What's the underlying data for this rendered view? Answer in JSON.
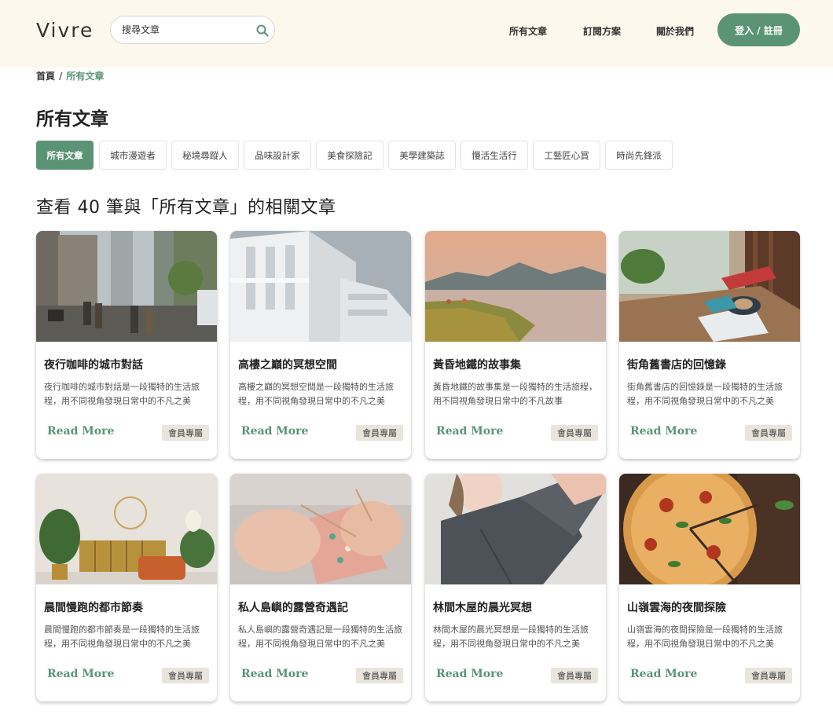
{
  "header": {
    "logo": "Vivre",
    "search": {
      "placeholder": "搜尋文章"
    },
    "nav": [
      {
        "label": "所有文章"
      },
      {
        "label": "訂閱方案"
      },
      {
        "label": "關於我們"
      }
    ],
    "login_label": "登入 / 註冊"
  },
  "breadcrumb": {
    "home": "首頁",
    "separator": "/",
    "current": "所有文章"
  },
  "page_title": "所有文章",
  "tabs": [
    {
      "label": "所有文章",
      "active": true
    },
    {
      "label": "城市漫遊者"
    },
    {
      "label": "秘境尋蹤人"
    },
    {
      "label": "品味設計家"
    },
    {
      "label": "美食探險記"
    },
    {
      "label": "美學建築誌"
    },
    {
      "label": "慢活生活行"
    },
    {
      "label": "工藝匠心賞"
    },
    {
      "label": "時尚先鋒派"
    }
  ],
  "results_heading": "查看 40 筆與「所有文章」的相關文章",
  "card_labels": {
    "read_more": "Read More",
    "badge": "會員專屬"
  },
  "cards": [
    {
      "title": "夜行咖啡的城市對話",
      "excerpt": "夜行咖啡的城市對話是一段獨特的生活旅程，用不同視角發現日常中的不凡之美",
      "image": "city-street"
    },
    {
      "title": "高樓之巔的冥想空間",
      "excerpt": "高樓之巔的冥想空間是一段獨特的生活旅程，用不同視角發現日常中的不凡之美",
      "image": "white-building"
    },
    {
      "title": "黃昏地鐵的故事集",
      "excerpt": "黃昏地鐵的故事集是一段獨特的生活旅程，用不同視角發現日常中的不凡故事",
      "image": "lake-camping"
    },
    {
      "title": "街角舊書店的回憶錄",
      "excerpt": "街角舊書店的回憶錄是一段獨特的生活旅程，用不同視角發現日常中的不凡之美",
      "image": "cafe-table"
    },
    {
      "title": "晨間慢跑的都市節奏",
      "excerpt": "晨間慢跑的都市節奏是一段獨特的生活旅程，用不同視角發現日常中的不凡之美",
      "image": "living-room"
    },
    {
      "title": "私人島嶼的露營奇遇記",
      "excerpt": "私人島嶼的露營奇遇記是一段獨特的生活旅程，用不同視角發現日常中的不凡之美",
      "image": "knitting"
    },
    {
      "title": "林間木屋的晨光冥想",
      "excerpt": "林間木屋的晨光冥想是一段獨特的生活旅程，用不同視角發現日常中的不凡之美",
      "image": "woman-shirt"
    },
    {
      "title": "山嶺雲海的夜間探險",
      "excerpt": "山嶺雲海的夜間探險是一段獨特的生活旅程，用不同視角發現日常中的不凡之美",
      "image": "pizza"
    }
  ],
  "colors": {
    "accent": "#5a9474",
    "header_bg": "#fdf8ec",
    "badge_bg": "#e9e5dc"
  }
}
